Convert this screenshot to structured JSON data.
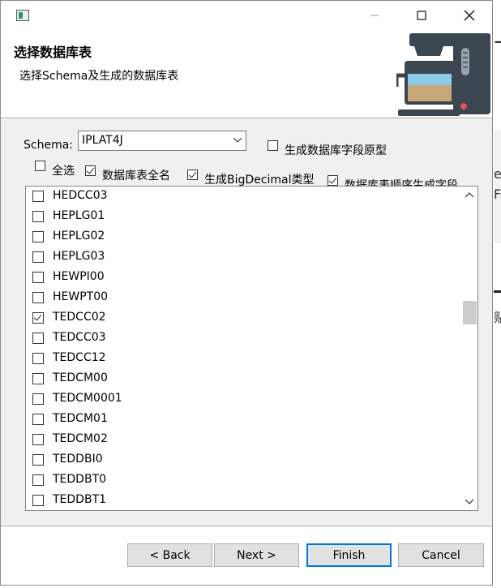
{
  "header": {
    "title": "选择数据库表",
    "description": "选择Schema及生成的数据库表"
  },
  "schema": {
    "label": "Schema:",
    "value": "IPLAT4J"
  },
  "options": {
    "generate_raw_fields": {
      "label": "生成数据库字段原型",
      "checked": false
    },
    "select_all": {
      "label": "全选",
      "checked": false
    },
    "full_table_name": {
      "label": "数据库表全名",
      "checked": true
    },
    "big_decimal": {
      "label": "生成BigDecimal类型",
      "checked": true
    },
    "field_order": {
      "label": "数据库表顺序生成字段",
      "checked": true
    }
  },
  "tables": [
    {
      "name": "HEDCC03",
      "checked": false
    },
    {
      "name": "HEPLG01",
      "checked": false
    },
    {
      "name": "HEPLG02",
      "checked": false
    },
    {
      "name": "HEPLG03",
      "checked": false
    },
    {
      "name": "HEWPI00",
      "checked": false
    },
    {
      "name": "HEWPT00",
      "checked": false
    },
    {
      "name": "TEDCC02",
      "checked": true
    },
    {
      "name": "TEDCC03",
      "checked": false
    },
    {
      "name": "TEDCC12",
      "checked": false
    },
    {
      "name": "TEDCM00",
      "checked": false
    },
    {
      "name": "TEDCM0001",
      "checked": false
    },
    {
      "name": "TEDCM01",
      "checked": false
    },
    {
      "name": "TEDCM02",
      "checked": false
    },
    {
      "name": "TEDDBI0",
      "checked": false
    },
    {
      "name": "TEDDBT0",
      "checked": false
    },
    {
      "name": "TEDDBT1",
      "checked": false
    }
  ],
  "buttons": {
    "back": "< Back",
    "next": "Next >",
    "finish": "Finish",
    "cancel": "Cancel"
  },
  "background_peek": [
    "e",
    "Fa",
    "贴"
  ]
}
